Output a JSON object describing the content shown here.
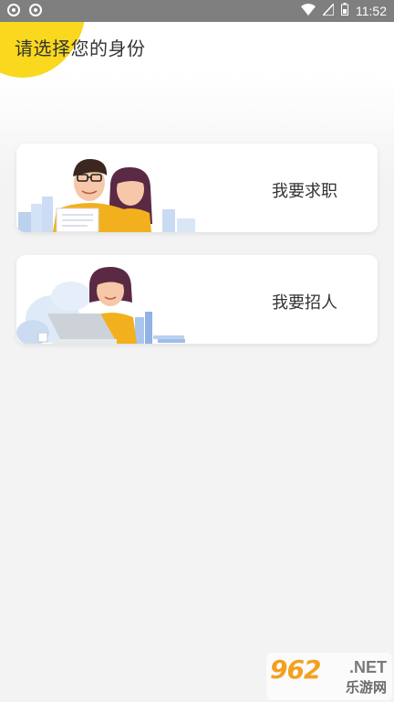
{
  "status_bar": {
    "time": "11:52",
    "icons": [
      "app-notification-icon",
      "app-notification-icon",
      "wifi-icon",
      "signal-icon",
      "battery-icon"
    ]
  },
  "page": {
    "title": "请选择您的身份"
  },
  "cards": [
    {
      "label": "我要求职",
      "illustration": "job-seeker-illustration"
    },
    {
      "label": "我要招人",
      "illustration": "recruiter-illustration"
    }
  ],
  "watermark": {
    "main": "962",
    "suffix": ".NET",
    "sub": "乐游网"
  },
  "colors": {
    "accent_yellow": "#f9d81e",
    "status_bar": "#7f7f7f",
    "background": "#f3f3f3",
    "card": "#ffffff",
    "text": "#333333"
  }
}
